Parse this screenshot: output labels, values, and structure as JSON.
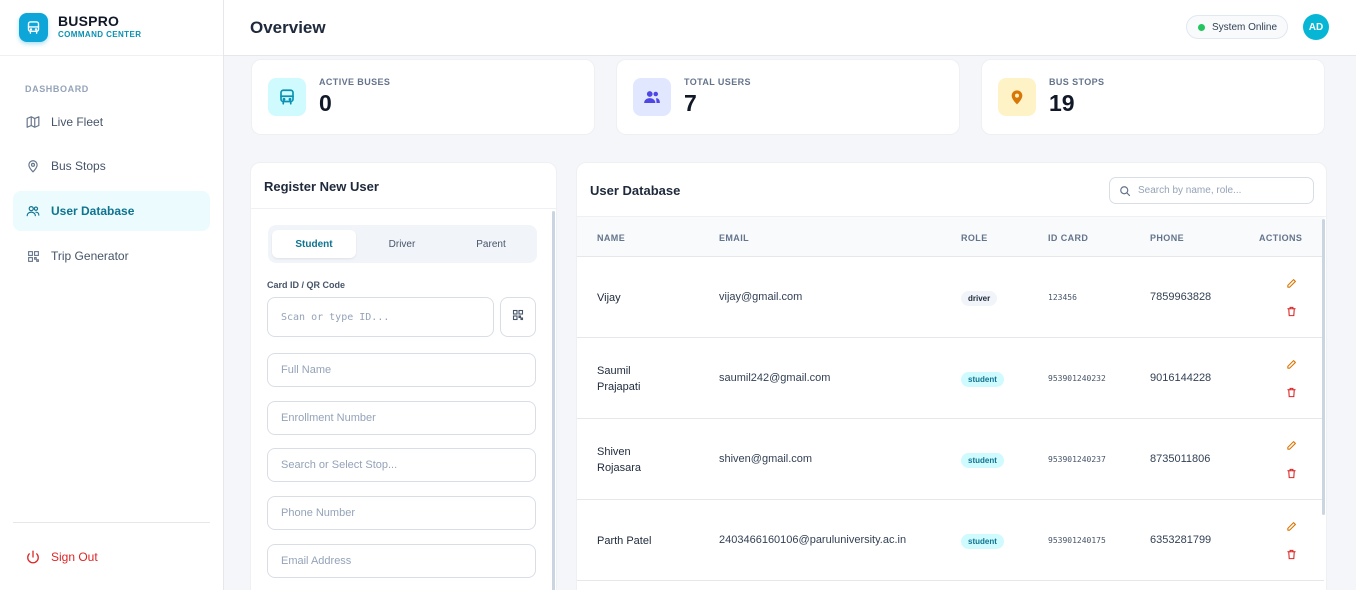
{
  "brand": {
    "title": "BUSPRO",
    "subtitle": "COMMAND CENTER"
  },
  "sidebar": {
    "section_label": "DASHBOARD",
    "items": [
      {
        "label": "Live Fleet",
        "icon": "map-icon",
        "active": false
      },
      {
        "label": "Bus Stops",
        "icon": "map-pin-icon",
        "active": false
      },
      {
        "label": "User Database",
        "icon": "users-icon",
        "active": true
      },
      {
        "label": "Trip Generator",
        "icon": "qr-code-icon",
        "active": false
      }
    ],
    "signout_label": "Sign Out"
  },
  "header": {
    "title": "Overview",
    "status": "System Online",
    "avatar_initials": "AD"
  },
  "stats": [
    {
      "label": "ACTIVE BUSES",
      "value": "0",
      "icon": "bus-icon",
      "color": "#0891b2"
    },
    {
      "label": "TOTAL USERS",
      "value": "7",
      "icon": "users-icon",
      "color": "#4f46e5"
    },
    {
      "label": "BUS STOPS",
      "value": "19",
      "icon": "map-pin-icon",
      "color": "#d97706"
    }
  ],
  "register": {
    "title": "Register New User",
    "tabs": [
      "Student",
      "Driver",
      "Parent"
    ],
    "active_tab": "Student",
    "card_label": "Card ID / QR Code",
    "placeholders": {
      "card_id": "Scan or type ID...",
      "full_name": "Full Name",
      "enrollment": "Enrollment Number",
      "stop": "Search or Select Stop...",
      "phone": "Phone Number",
      "email": "Email Address"
    }
  },
  "user_db": {
    "title": "User Database",
    "search_placeholder": "Search by name, role...",
    "columns": [
      "NAME",
      "EMAIL",
      "ROLE",
      "ID CARD",
      "PHONE",
      "ACTIONS"
    ],
    "rows": [
      {
        "name": "Vijay",
        "email": "vijay@gmail.com",
        "role": "driver",
        "id_card": "123456",
        "phone": "7859963828"
      },
      {
        "name": "Saumil Prajapati",
        "email": "saumil242@gmail.com",
        "role": "student",
        "id_card": "953901240232",
        "phone": "9016144228"
      },
      {
        "name": "Shiven Rojasara",
        "email": "shiven@gmail.com",
        "role": "student",
        "id_card": "953901240237",
        "phone": "8735011806"
      },
      {
        "name": "Parth Patel",
        "email": "2403466160106@paruluniversity.ac.in",
        "role": "student",
        "id_card": "953901240175",
        "phone": "6353281799"
      }
    ]
  },
  "colors": {
    "accent": "#06b6d4",
    "danger": "#dc2626",
    "edit": "#d97706",
    "online": "#22c55e"
  }
}
